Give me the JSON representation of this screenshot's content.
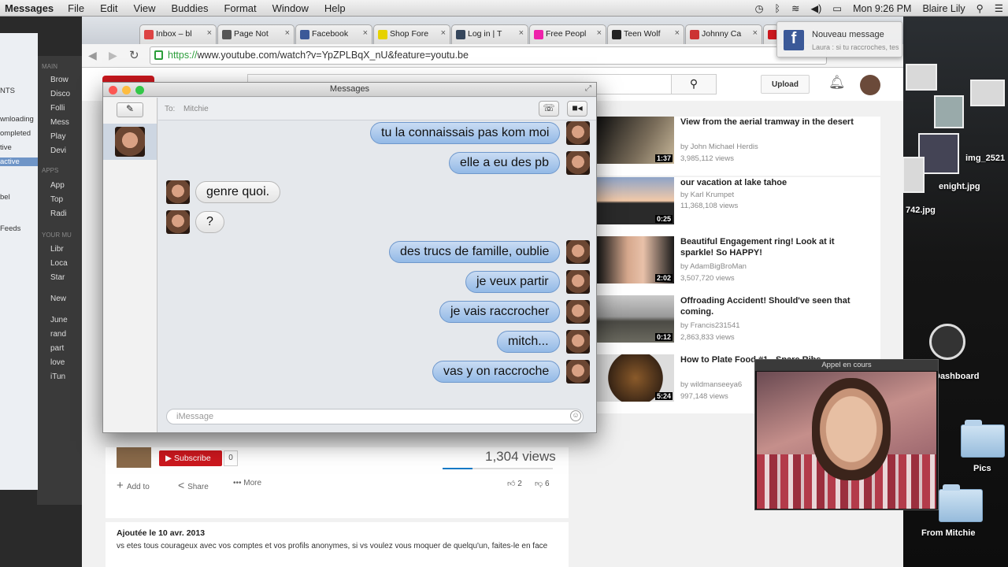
{
  "menubar": {
    "app": "Messages",
    "items": [
      "File",
      "Edit",
      "View",
      "Buddies",
      "Format",
      "Window",
      "Help"
    ],
    "clock": "Mon 9:26 PM",
    "user": "Blaire Lily"
  },
  "browser": {
    "tabs": [
      "Inbox – bl",
      "Page Not",
      "Facebook",
      "Shop Fore",
      "Log in | T",
      "Free Peopl",
      "Teen Wolf",
      "Johnny Ca"
    ],
    "url_scheme": "https://",
    "url_rest": "www.youtube.com/watch?v=YpZPLBqX_nU&feature=youtu.be"
  },
  "youtube": {
    "upload_label": "Upload",
    "subscribe_label": "Subscribe",
    "subscribe_count": "0",
    "views": "1,304 views",
    "add_to": "Add to",
    "share": "Share",
    "more": "More",
    "likes": "2",
    "dislikes": "6",
    "published": "Ajoutée le 10 avr. 2013",
    "description": "vs etes tous courageux avec vos comptes et vos profils anonymes, si vs voulez vous moquer de quelqu'un, faites-le en face",
    "related": [
      {
        "title": "View from the aerial tramway in the desert",
        "channel": "by John Michael Herdis",
        "views": "3,985,112 views",
        "duration": "1:37"
      },
      {
        "title": "our vacation at lake tahoe",
        "channel": "by Karl Krumpet",
        "views": "11,368,108 views",
        "duration": "0:25"
      },
      {
        "title": "Beautiful Engagement ring! Look at it sparkle! So HAPPY!",
        "channel": "by AdamBigBroMan",
        "views": "3,507,720 views",
        "duration": "2:02"
      },
      {
        "title": "Offroading Accident! Should've seen that coming.",
        "channel": "by Francis231541",
        "views": "2,863,833 views",
        "duration": "0:12"
      },
      {
        "title": "How to Plate Food #1 - Spare Ribs",
        "channel": "by wildmanseeya6",
        "views": "997,148 views",
        "duration": "5:24"
      }
    ]
  },
  "messages": {
    "window_title": "Messages",
    "to_label": "To:",
    "recipient": "Mitchie",
    "input_placeholder": "iMessage",
    "conversation": [
      {
        "from": "me",
        "text": "tu la connaissais pas kom moi"
      },
      {
        "from": "me",
        "text": "elle a eu des pb"
      },
      {
        "from": "them",
        "text": "genre quoi."
      },
      {
        "from": "them",
        "text": "?"
      },
      {
        "from": "me",
        "text": "des trucs de famille, oublie"
      },
      {
        "from": "me",
        "text": "je veux partir"
      },
      {
        "from": "me",
        "text": "je vais raccrocher"
      },
      {
        "from": "me",
        "text": "mitch..."
      },
      {
        "from": "me",
        "text": "vas y on raccroche"
      }
    ]
  },
  "notification": {
    "title": "Nouveau message",
    "body": "Laura : si tu raccroches, tes amis vont mourir"
  },
  "facetime": {
    "title": "Appel en cours"
  },
  "desktop": {
    "labels": [
      "img_2521",
      "enight.jpg",
      "742.jpg",
      "Dashboard",
      "Pics",
      "From Mitchie"
    ]
  },
  "itunes": {
    "headers": [
      "MAIN",
      "APPS",
      "YOUR MU"
    ],
    "items": [
      "Brow",
      "Disco",
      "Folli",
      "Mess",
      "Play",
      "Devi",
      "App",
      "Top",
      "Radi",
      "Libr",
      "Loca",
      "Star",
      "New",
      "June",
      "rand",
      "part",
      "love",
      "iTun"
    ],
    "finder_items": [
      "NTS",
      "wnloading",
      "ompleted",
      "tive",
      "active",
      "bel",
      "Feeds"
    ]
  },
  "colors": {
    "outgoing_bubble": "#93b9e6",
    "incoming_bubble": "#e4e4e4",
    "facebook": "#3b5998",
    "youtube_red": "#cc181e",
    "https_green": "#2b9e3a"
  }
}
